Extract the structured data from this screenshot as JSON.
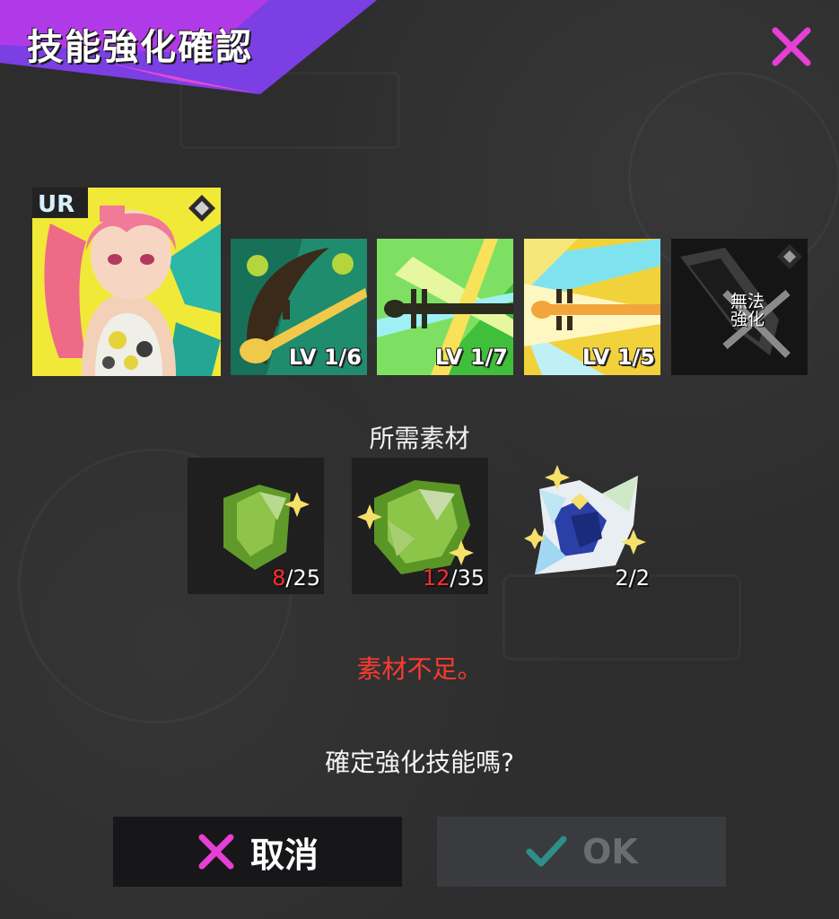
{
  "dialog": {
    "title": "技能強化確認",
    "accent_color": "#cc33e6",
    "close_icon": "close-icon"
  },
  "character": {
    "rarity": "UR",
    "icon": "character-portrait"
  },
  "skills": [
    {
      "level": "LV 1/6",
      "icon": "guitar-skill-icon"
    },
    {
      "level": "LV 1/7",
      "icon": "violin-skill-icon"
    },
    {
      "level": "LV 1/5",
      "icon": "violin-skill-icon"
    },
    {
      "status": "無法\n強化",
      "icon": "locked-skill-icon"
    }
  ],
  "materials": {
    "label": "所需素材",
    "items": [
      {
        "have": "8",
        "need": "/25",
        "icon": "green-gem-small-icon",
        "status_color": "#ff2d2d"
      },
      {
        "have": "12",
        "need": "/35",
        "icon": "green-gem-large-icon",
        "status_color": "#ff2d2d"
      },
      {
        "have": "2/2",
        "need": "",
        "icon": "blue-crystal-icon"
      }
    ]
  },
  "warning": "素材不足。",
  "confirm_question": "確定強化技能嗎?",
  "buttons": {
    "cancel": "取消",
    "ok": "OK"
  }
}
